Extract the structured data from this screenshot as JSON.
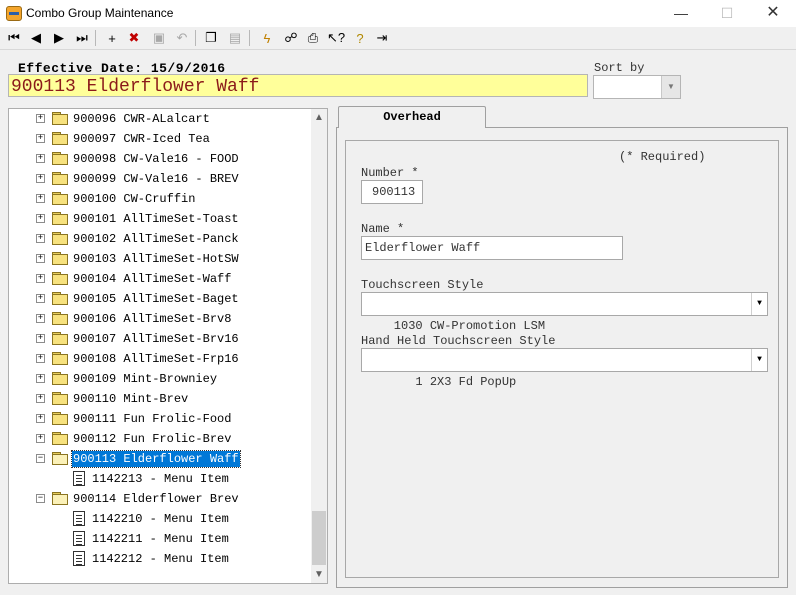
{
  "window": {
    "title": "Combo Group Maintenance"
  },
  "header": {
    "effective_date": "Effective Date: 15/9/2016",
    "item_title": "900113 Elderflower Waff",
    "sort_by_label": "Sort by",
    "sort_by_value": ""
  },
  "toolbar": {
    "buttons": [
      {
        "name": "first-record",
        "icon": "first-record-icon"
      },
      {
        "name": "previous-record",
        "icon": "previous-record-icon"
      },
      {
        "name": "next-record",
        "icon": "next-record-icon"
      },
      {
        "name": "last-record",
        "icon": "last-record-icon"
      },
      {
        "name": "add",
        "icon": "add-icon"
      },
      {
        "name": "delete",
        "icon": "delete-icon"
      },
      {
        "name": "save",
        "icon": "save-icon",
        "disabled": true
      },
      {
        "name": "undo",
        "icon": "undo-icon",
        "disabled": true
      },
      {
        "name": "copy",
        "icon": "copy-icon"
      },
      {
        "name": "paste",
        "icon": "paste-icon",
        "disabled": true
      },
      {
        "name": "execute",
        "icon": "lightning-icon"
      },
      {
        "name": "find",
        "icon": "binoculars-icon"
      },
      {
        "name": "print",
        "icon": "printer-icon"
      },
      {
        "name": "context-help",
        "icon": "help-pointer-icon"
      },
      {
        "name": "help",
        "icon": "lightbulb-icon"
      },
      {
        "name": "exit",
        "icon": "exit-icon"
      }
    ]
  },
  "tree": {
    "items": [
      {
        "label": "900096 CWR-ALalcart",
        "type": "folder",
        "level": 0,
        "expanded": false
      },
      {
        "label": "900097 CWR-Iced Tea",
        "type": "folder",
        "level": 0,
        "expanded": false
      },
      {
        "label": "900098 CW-Vale16 - FOOD",
        "type": "folder",
        "level": 0,
        "expanded": false
      },
      {
        "label": "900099 CW-Vale16 - BREV",
        "type": "folder",
        "level": 0,
        "expanded": false
      },
      {
        "label": "900100 CW-Cruffin",
        "type": "folder",
        "level": 0,
        "expanded": false
      },
      {
        "label": "900101 AllTimeSet-Toast",
        "type": "folder",
        "level": 0,
        "expanded": false
      },
      {
        "label": "900102 AllTimeSet-Panck",
        "type": "folder",
        "level": 0,
        "expanded": false
      },
      {
        "label": "900103 AllTimeSet-HotSW",
        "type": "folder",
        "level": 0,
        "expanded": false
      },
      {
        "label": "900104 AllTimeSet-Waff",
        "type": "folder",
        "level": 0,
        "expanded": false
      },
      {
        "label": "900105 AllTimeSet-Baget",
        "type": "folder",
        "level": 0,
        "expanded": false
      },
      {
        "label": "900106 AllTimeSet-Brv8",
        "type": "folder",
        "level": 0,
        "expanded": false
      },
      {
        "label": "900107 AllTimeSet-Brv16",
        "type": "folder",
        "level": 0,
        "expanded": false
      },
      {
        "label": "900108 AllTimeSet-Frp16",
        "type": "folder",
        "level": 0,
        "expanded": false
      },
      {
        "label": "900109 Mint-Browniey",
        "type": "folder",
        "level": 0,
        "expanded": false
      },
      {
        "label": "900110 Mint-Brev",
        "type": "folder",
        "level": 0,
        "expanded": false
      },
      {
        "label": "900111 Fun Frolic-Food",
        "type": "folder",
        "level": 0,
        "expanded": false
      },
      {
        "label": "900112 Fun Frolic-Brev",
        "type": "folder",
        "level": 0,
        "expanded": false
      },
      {
        "label": "900113 Elderflower Waff",
        "type": "folder",
        "level": 0,
        "expanded": true,
        "selected": true
      },
      {
        "label": "1142213 - Menu Item",
        "type": "item",
        "level": 1
      },
      {
        "label": "900114 Elderflower Brev",
        "type": "folder",
        "level": 0,
        "expanded": true
      },
      {
        "label": "1142210 - Menu Item",
        "type": "item",
        "level": 1
      },
      {
        "label": "1142211 - Menu Item",
        "type": "item",
        "level": 1
      },
      {
        "label": "1142212 - Menu Item",
        "type": "item",
        "level": 1
      }
    ]
  },
  "tabs": [
    {
      "label": "Overhead",
      "active": true
    }
  ],
  "form": {
    "required_note": "(* Required)",
    "number_label": "Number *",
    "number_value": "900113",
    "name_label": "Name *",
    "name_value": "Elderflower Waff",
    "touchscreen_label": "Touchscreen Style",
    "touchscreen_value": "  1030 CW-Promotion LSM",
    "handheld_label": "Hand Held Touchscreen Style",
    "handheld_value": "     1 2X3 Fd PopUp"
  }
}
